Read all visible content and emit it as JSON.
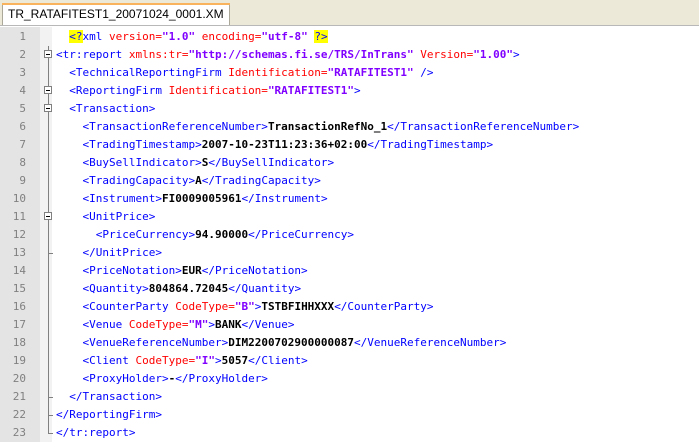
{
  "tab": {
    "label": "TR_RATAFITEST1_20071024_0001.XM"
  },
  "lines": [
    {
      "num": "1",
      "indent": "  ",
      "fold": "none",
      "parts": [
        [
          "pi",
          "<?"
        ],
        [
          "t",
          "xml "
        ],
        [
          "a",
          "version="
        ],
        [
          "v",
          "\"1.0\""
        ],
        [
          "a",
          " encoding="
        ],
        [
          "v",
          "\"utf-8\""
        ],
        [
          "t",
          " "
        ],
        [
          "pi",
          "?>"
        ]
      ]
    },
    {
      "num": "2",
      "indent": "",
      "fold": "open",
      "parts": [
        [
          "t",
          "<tr:report "
        ],
        [
          "a",
          "xmlns:tr="
        ],
        [
          "v",
          "\"http://schemas.fi.se/TRS/InTrans\""
        ],
        [
          "a",
          " Version="
        ],
        [
          "v",
          "\"1.00\""
        ],
        [
          "t",
          ">"
        ]
      ]
    },
    {
      "num": "3",
      "indent": "  ",
      "fold": "line",
      "parts": [
        [
          "t",
          "<TechnicalReportingFirm "
        ],
        [
          "a",
          "Identification="
        ],
        [
          "v",
          "\"RATAFITEST1\""
        ],
        [
          "t",
          " />"
        ]
      ]
    },
    {
      "num": "4",
      "indent": "  ",
      "fold": "open",
      "parts": [
        [
          "t",
          "<ReportingFirm "
        ],
        [
          "a",
          "Identification="
        ],
        [
          "v",
          "\"RATAFITEST1\""
        ],
        [
          "t",
          ">"
        ]
      ]
    },
    {
      "num": "5",
      "indent": "  ",
      "fold": "open",
      "parts": [
        [
          "t",
          "<Transaction>"
        ]
      ]
    },
    {
      "num": "6",
      "indent": "    ",
      "fold": "line",
      "parts": [
        [
          "t",
          "<TransactionReferenceNumber>"
        ],
        [
          "x",
          "TransactionRefNo_1"
        ],
        [
          "t",
          "</TransactionReferenceNumber>"
        ]
      ]
    },
    {
      "num": "7",
      "indent": "    ",
      "fold": "line",
      "parts": [
        [
          "t",
          "<TradingTimestamp>"
        ],
        [
          "x",
          "2007-10-23T11:23:36+02:00"
        ],
        [
          "t",
          "</TradingTimestamp>"
        ]
      ]
    },
    {
      "num": "8",
      "indent": "    ",
      "fold": "line",
      "parts": [
        [
          "t",
          "<BuySellIndicator>"
        ],
        [
          "x",
          "S"
        ],
        [
          "t",
          "</BuySellIndicator>"
        ]
      ]
    },
    {
      "num": "9",
      "indent": "    ",
      "fold": "line",
      "parts": [
        [
          "t",
          "<TradingCapacity>"
        ],
        [
          "x",
          "A"
        ],
        [
          "t",
          "</TradingCapacity>"
        ]
      ]
    },
    {
      "num": "10",
      "indent": "    ",
      "fold": "line",
      "parts": [
        [
          "t",
          "<Instrument>"
        ],
        [
          "x",
          "FI0009005961"
        ],
        [
          "t",
          "</Instrument>"
        ]
      ]
    },
    {
      "num": "11",
      "indent": "    ",
      "fold": "open",
      "parts": [
        [
          "t",
          "<UnitPrice>"
        ]
      ]
    },
    {
      "num": "12",
      "indent": "      ",
      "fold": "line",
      "parts": [
        [
          "t",
          "<PriceCurrency>"
        ],
        [
          "x",
          "94.90000"
        ],
        [
          "t",
          "</PriceCurrency>"
        ]
      ]
    },
    {
      "num": "13",
      "indent": "    ",
      "fold": "close",
      "parts": [
        [
          "t",
          "</UnitPrice>"
        ]
      ]
    },
    {
      "num": "14",
      "indent": "    ",
      "fold": "line",
      "parts": [
        [
          "t",
          "<PriceNotation>"
        ],
        [
          "x",
          "EUR"
        ],
        [
          "t",
          "</PriceNotation>"
        ]
      ]
    },
    {
      "num": "15",
      "indent": "    ",
      "fold": "line",
      "parts": [
        [
          "t",
          "<Quantity>"
        ],
        [
          "x",
          "804864.72045"
        ],
        [
          "t",
          "</Quantity>"
        ]
      ]
    },
    {
      "num": "16",
      "indent": "    ",
      "fold": "line",
      "parts": [
        [
          "t",
          "<CounterParty "
        ],
        [
          "a",
          "CodeType="
        ],
        [
          "v",
          "\"B\""
        ],
        [
          "t",
          ">"
        ],
        [
          "x",
          "TSTBFIHHXXX"
        ],
        [
          "t",
          "</CounterParty>"
        ]
      ]
    },
    {
      "num": "17",
      "indent": "    ",
      "fold": "line",
      "parts": [
        [
          "t",
          "<Venue "
        ],
        [
          "a",
          "CodeType="
        ],
        [
          "v",
          "\"M\""
        ],
        [
          "t",
          ">"
        ],
        [
          "x",
          "BANK"
        ],
        [
          "t",
          "</Venue>"
        ]
      ]
    },
    {
      "num": "18",
      "indent": "    ",
      "fold": "line",
      "parts": [
        [
          "t",
          "<VenueReferenceNumber>"
        ],
        [
          "x",
          "DIM2200702900000087"
        ],
        [
          "t",
          "</VenueReferenceNumber>"
        ]
      ]
    },
    {
      "num": "19",
      "indent": "    ",
      "fold": "line",
      "parts": [
        [
          "t",
          "<Client "
        ],
        [
          "a",
          "CodeType="
        ],
        [
          "v",
          "\"I\""
        ],
        [
          "t",
          ">"
        ],
        [
          "x",
          "5057"
        ],
        [
          "t",
          "</Client>"
        ]
      ]
    },
    {
      "num": "20",
      "indent": "    ",
      "fold": "line",
      "parts": [
        [
          "t",
          "<ProxyHolder>"
        ],
        [
          "x",
          "-"
        ],
        [
          "t",
          "</ProxyHolder>"
        ]
      ]
    },
    {
      "num": "21",
      "indent": "  ",
      "fold": "close",
      "parts": [
        [
          "t",
          "</Transaction>"
        ]
      ]
    },
    {
      "num": "22",
      "indent": "",
      "fold": "close",
      "parts": [
        [
          "t",
          "</ReportingFirm>"
        ]
      ]
    },
    {
      "num": "23",
      "indent": "",
      "fold": "end",
      "parts": [
        [
          "t",
          "</tr:report>"
        ]
      ]
    }
  ]
}
